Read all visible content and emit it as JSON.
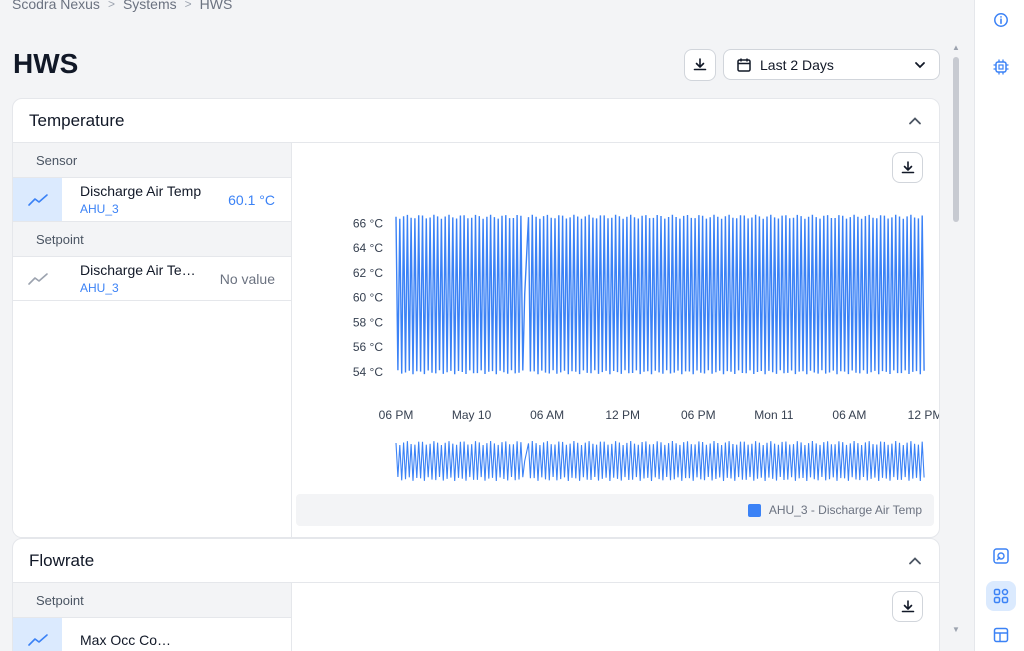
{
  "breadcrumb": {
    "items": [
      "Scodra Nexus",
      "Systems",
      "HWS"
    ]
  },
  "page": {
    "title": "HWS"
  },
  "toolbar": {
    "range_label": "Last 2 Days"
  },
  "sections": [
    {
      "title": "Temperature",
      "groups": [
        {
          "label": "Sensor",
          "rows": [
            {
              "name": "Discharge Air Temp",
              "equip": "AHU_3",
              "value": "60.1 °C",
              "selected": true
            }
          ]
        },
        {
          "label": "Setpoint",
          "rows": [
            {
              "name": "Discharge Air Te…",
              "equip": "AHU_3",
              "value": "No value",
              "selected": false
            }
          ]
        }
      ],
      "legend": "AHU_3 - Discharge Air Temp"
    },
    {
      "title": "Flowrate",
      "groups": [
        {
          "label": "Setpoint",
          "rows": [
            {
              "name": "Max Occ Co…",
              "equip": "",
              "value": "",
              "selected": true
            }
          ]
        }
      ]
    }
  ],
  "colors": {
    "series": "#3b82f6",
    "accent": "#3b82f6"
  },
  "chart_data": {
    "type": "line",
    "title": "",
    "x_ticks": [
      "06 PM",
      "May 10",
      "06 AM",
      "12 PM",
      "06 PM",
      "Mon 11",
      "06 AM",
      "12 PM"
    ],
    "y_ticks": [
      "54 °C",
      "56 °C",
      "58 °C",
      "60 °C",
      "62 °C",
      "64 °C",
      "66 °C"
    ],
    "ylim": [
      53.5,
      67
    ],
    "series": [
      {
        "name": "AHU_3 - Discharge Air Temp",
        "oscillation_min": 53.8,
        "oscillation_max": 66.7,
        "cycles": 140
      }
    ],
    "legend_position": "bottom-right",
    "grid": false
  },
  "icons": {
    "download": "download-icon",
    "calendar": "calendar-icon",
    "chevron": "chevron-down-icon",
    "collapse": "chevron-up-icon",
    "trend": "trend-line-icon",
    "info": "info-icon",
    "settings": "chip-icon",
    "dashboard": "grid-icon"
  }
}
